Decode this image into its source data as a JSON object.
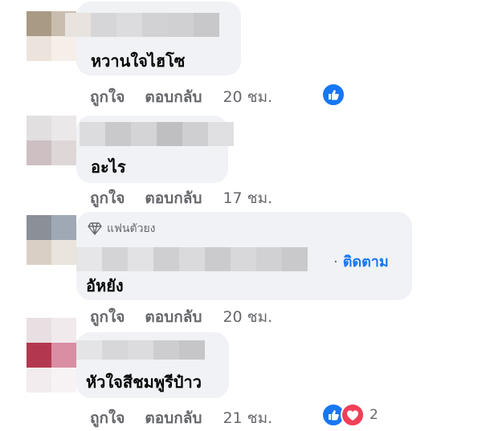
{
  "comments": [
    {
      "text": "หวานใจไฮโซ",
      "actions": {
        "like": "ถูกใจ",
        "reply": "ตอบกลับ",
        "time": "20 ชม."
      },
      "reactions": {
        "icons": [
          "like-icon"
        ],
        "count": ""
      }
    },
    {
      "text": "อะไร",
      "actions": {
        "like": "ถูกใจ",
        "reply": "ตอบกลับ",
        "time": "17 ชม."
      }
    },
    {
      "badge": "แฟนตัวยง",
      "follow": "ติดตาม",
      "text": "อัหยัง",
      "actions": {
        "like": "ถูกใจ",
        "reply": "ตอบกลับ",
        "time": "20 ชม."
      }
    },
    {
      "text": "หัวใจสีชมพูรีป๋าว",
      "actions": {
        "like": "ถูกใจ",
        "reply": "ตอบกลับ",
        "time": "21 ชม."
      },
      "reactions": {
        "icons": [
          "like-icon",
          "love-icon"
        ],
        "count": "2"
      }
    }
  ],
  "colors": {
    "link": "#1877f2",
    "bubble": "#f0f2f5",
    "muted": "#65676b",
    "like": "#1877f2",
    "love": "#f33e58"
  }
}
